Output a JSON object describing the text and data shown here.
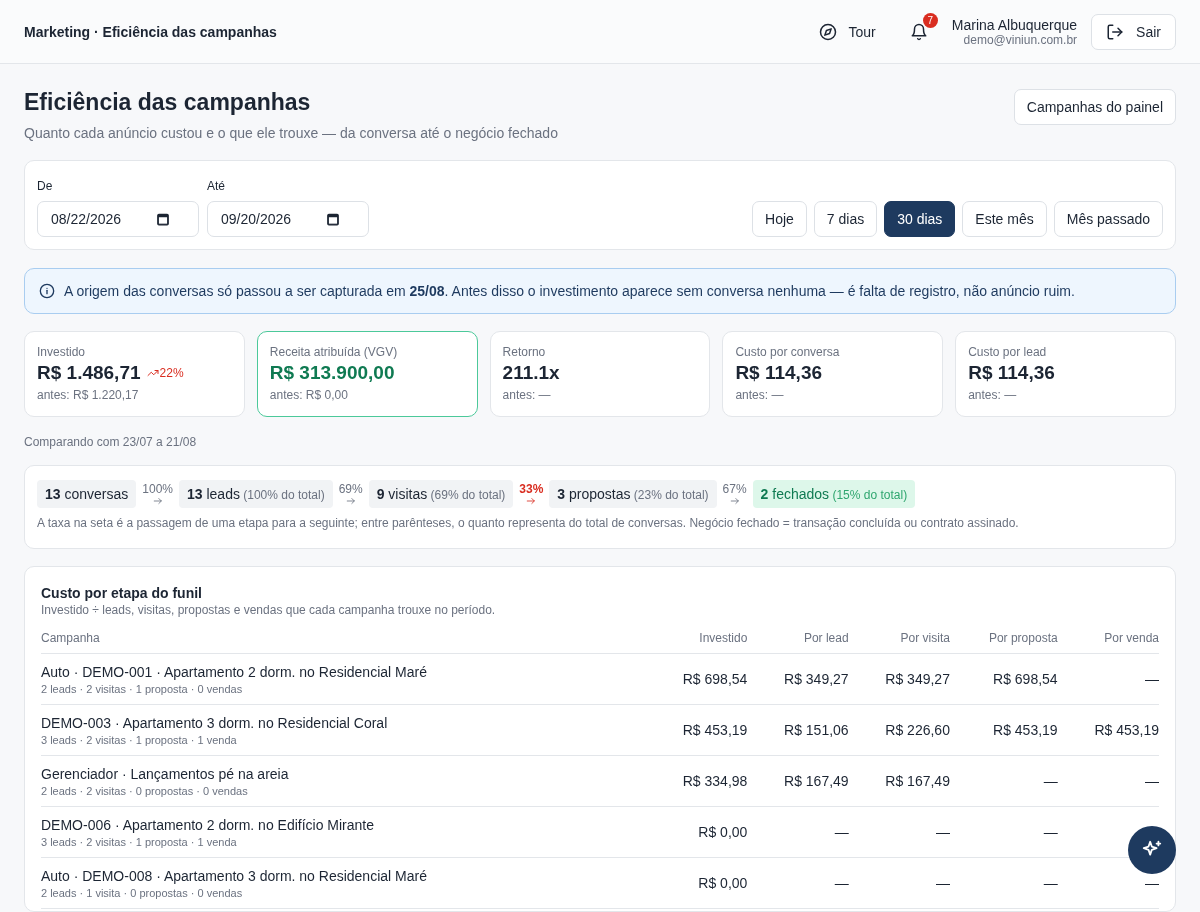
{
  "header": {
    "breadcrumb": "Marketing · Eficiência das campanhas",
    "tour": "Tour",
    "notifications": "7",
    "user_name": "Marina Albuquerque",
    "user_email": "demo@viniun.com.br",
    "logout": "Sair"
  },
  "page": {
    "title": "Eficiência das campanhas",
    "subtitle": "Quanto cada anúncio custou e o que ele trouxe — da conversa até o negócio fechado",
    "panel_button": "Campanhas do painel"
  },
  "filters": {
    "from": {
      "label": "De",
      "value": "08/22/2026"
    },
    "to": {
      "label": "Até",
      "value": "09/20/2026"
    },
    "presets": [
      {
        "label": "Hoje",
        "selected": false
      },
      {
        "label": "7 dias",
        "selected": false
      },
      {
        "label": "30 dias",
        "selected": true
      },
      {
        "label": "Este mês",
        "selected": false
      },
      {
        "label": "Mês passado",
        "selected": false
      }
    ]
  },
  "notice": "A origem das conversas só passou a ser capturada em **25/08**. Antes disso o investimento aparece sem conversa nenhuma — é falta de registro, não anúncio ruim.",
  "kpis": [
    {
      "label": "Investido",
      "value": "R$ 1.486,71",
      "delta": "22%",
      "previous": "antes: R$ 1.220,17",
      "highlighted": false
    },
    {
      "label": "Receita atribuída (VGV)",
      "value": "R$ 313.900,00",
      "previous": "antes: R$ 0,00",
      "highlighted": true
    },
    {
      "label": "Retorno",
      "value": "211.1x",
      "previous": "antes: —",
      "highlighted": false
    },
    {
      "label": "Custo por conversa",
      "value": "R$ 114,36",
      "previous": "antes: —",
      "highlighted": false
    },
    {
      "label": "Custo por lead",
      "value": "R$ 114,36",
      "previous": "antes: —",
      "highlighted": false
    }
  ],
  "comparison": "Comparando com 23/07 a 21/08",
  "funnel": {
    "stages": [
      {
        "count": "13",
        "label": "conversas",
        "kind": "plain"
      },
      {
        "count": "13",
        "label": "leads",
        "share": "(100% do total)",
        "kind": "plain"
      },
      {
        "count": "9",
        "label": "visitas",
        "share": "(69% do total)",
        "kind": "plain"
      },
      {
        "count": "3",
        "label": "propostas",
        "share": "(23% do total)",
        "kind": "plain"
      },
      {
        "count": "2",
        "label": "fechados",
        "share": "(15% do total)",
        "kind": "success"
      }
    ],
    "rates": [
      {
        "rate": "100%",
        "alert": false
      },
      {
        "rate": "69%",
        "alert": false
      },
      {
        "rate": "33%",
        "alert": true
      },
      {
        "rate": "67%",
        "alert": false
      }
    ],
    "note": "A taxa na seta é a passagem de uma etapa para a seguinte; entre parênteses, o quanto representa do total de conversas. Negócio fechado = transação concluída ou contrato assinado."
  },
  "table": {
    "title": "Custo por etapa do funil",
    "subtitle": "Investido ÷ leads, visitas, propostas e vendas que cada campanha trouxe no período.",
    "columns": [
      "Campanha",
      "Investido",
      "Por lead",
      "Por visita",
      "Por proposta",
      "Por venda"
    ],
    "rows": [
      {
        "details": "2 leads · 2 visitas · 1 proposta · 0 vendas",
        "cells": [
          "Auto · DEMO-001 · Apartamento 2 dorm. no Residencial Maré",
          "R$ 698,54",
          "R$ 349,27",
          "R$ 349,27",
          "R$ 698,54",
          "—"
        ]
      },
      {
        "details": "3 leads · 2 visitas · 1 proposta · 1 venda",
        "cells": [
          "DEMO-003 · Apartamento 3 dorm. no Residencial Coral",
          "R$ 453,19",
          "R$ 151,06",
          "R$ 226,60",
          "R$ 453,19",
          "R$ 453,19"
        ]
      },
      {
        "details": "2 leads · 2 visitas · 0 propostas · 0 vendas",
        "cells": [
          "Gerenciador · Lançamentos pé na areia",
          "R$ 334,98",
          "R$ 167,49",
          "R$ 167,49",
          "—",
          "—"
        ]
      },
      {
        "details": "3 leads · 2 visitas · 1 proposta · 1 venda",
        "cells": [
          "DEMO-006 · Apartamento 2 dorm. no Edifício Mirante",
          "R$ 0,00",
          "—",
          "—",
          "—"
        ]
      },
      {
        "details": "2 leads · 1 visita · 0 propostas · 0 vendas",
        "cells": [
          "Auto · DEMO-008 · Apartamento 3 dorm. no Residencial Maré",
          "R$ 0,00",
          "—",
          "—",
          "—",
          "—"
        ]
      }
    ]
  }
}
